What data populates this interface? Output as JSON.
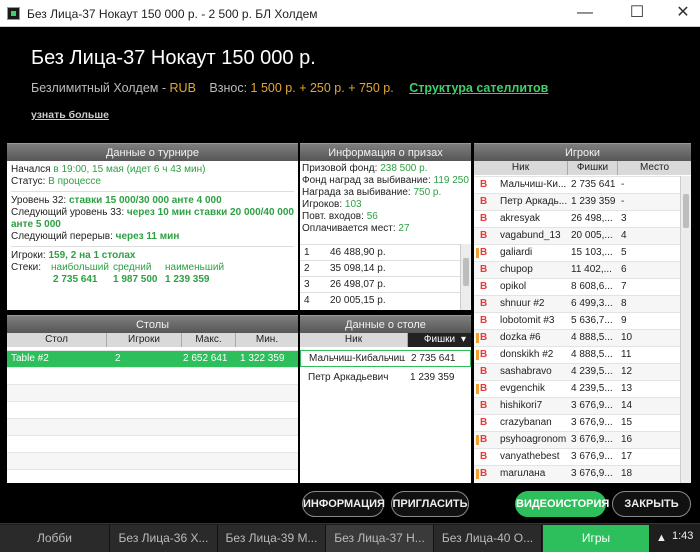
{
  "window": {
    "title": "Без Лица-37 Нокаут 150 000 р. - 2 500 р. БЛ Холдем",
    "min": "—",
    "max": "☐",
    "close": "✕"
  },
  "header": {
    "title": "Без Лица-37 Нокаут 150 000 р.",
    "game": "Безлимитный Холдем - ",
    "currency": "RUB",
    "fee_label": "Взнос:",
    "fee_value": "1 500 р. + 250 р. + 750 р.",
    "satellites_link": "Структура сателлитов",
    "learn_more": "узнать больше"
  },
  "tournament": {
    "heading": "Данные о турнире",
    "started_label": "Начался",
    "started_value": "в 19:00, 15 мая (идет 6 ч 43 мин)",
    "status_label": "Статус:",
    "status_value": "В процессе",
    "level_label": "Уровень 32:",
    "level_value": "ставки 15 000/30 000 анте 4 000",
    "next_level_label": "Следующий уровень 33:",
    "next_level_value": "через 10 мин ставки 20 000/40 000 анте 5 000",
    "next_break_label": "Следующий перерыв:",
    "next_break_value": "через 11 мин",
    "players_label": "Игроки:",
    "players_value": "159, 2 на 1 столах",
    "stacks_label": "Стеки:",
    "stack_largest_label": "наибольший",
    "stack_avg_label": "средний",
    "stack_smallest_label": "наименьший",
    "stack_largest": "2 735 641",
    "stack_avg": "1 987 500",
    "stack_smallest": "1 239 359"
  },
  "prizes": {
    "heading": "Информация о призах",
    "pool_label": "Призовой фонд:",
    "pool_value": "238 500 р.",
    "ko_fund_label": "Фонд наград за выбивание:",
    "ko_fund_value": "119 250 р.",
    "ko_reward_label": "Награда за выбивание:",
    "ko_reward_value": "750 р.",
    "players_label": "Игроков:",
    "players_value": "103",
    "reentries_label": "Повт. входов:",
    "reentries_value": "56",
    "paid_label": "Оплачивается мест:",
    "paid_value": "27",
    "table": [
      {
        "place": "1",
        "prize": "46 488,90 р."
      },
      {
        "place": "2",
        "prize": "35 098,14 р."
      },
      {
        "place": "3",
        "prize": "26 498,07 р."
      },
      {
        "place": "4",
        "prize": "20 005,15 р."
      }
    ]
  },
  "players_panel": {
    "heading": "Игроки",
    "col_nick": "Ник",
    "col_chips": "Фишки",
    "col_place": "Место",
    "rows": [
      {
        "nick": "Мальчиш-Ки...",
        "chips": "2 735 641",
        "place": "-",
        "mark": false
      },
      {
        "nick": "Петр Аркадь...",
        "chips": "1 239 359",
        "place": "-",
        "mark": false
      },
      {
        "nick": "akresyak",
        "chips": "26 498,...",
        "place": "3",
        "mark": false
      },
      {
        "nick": "vagabund_13",
        "chips": "20 005,...",
        "place": "4",
        "mark": false
      },
      {
        "nick": "galiardi",
        "chips": "15 103,...",
        "place": "5",
        "mark": true
      },
      {
        "nick": "chupop",
        "chips": "11 402,...",
        "place": "6",
        "mark": false
      },
      {
        "nick": "opikol",
        "chips": "8 608,6...",
        "place": "7",
        "mark": false
      },
      {
        "nick": "shnuur #2",
        "chips": "6 499,3...",
        "place": "8",
        "mark": false
      },
      {
        "nick": "lobotomit #3",
        "chips": "5 636,7...",
        "place": "9",
        "mark": false
      },
      {
        "nick": "dozka #6",
        "chips": "4 888,5...",
        "place": "10",
        "mark": true
      },
      {
        "nick": "donskikh #2",
        "chips": "4 888,5...",
        "place": "11",
        "mark": true
      },
      {
        "nick": "sashabravo",
        "chips": "4 239,5...",
        "place": "12",
        "mark": false
      },
      {
        "nick": "evgenchik",
        "chips": "4 239,5...",
        "place": "13",
        "mark": true
      },
      {
        "nick": "hishikori7",
        "chips": "3 676,9...",
        "place": "14",
        "mark": false
      },
      {
        "nick": "crazybanan",
        "chips": "3 676,9...",
        "place": "15",
        "mark": false
      },
      {
        "nick": "psyhoagronom",
        "chips": "3 676,9...",
        "place": "16",
        "mark": true
      },
      {
        "nick": "vanyathebest",
        "chips": "3 676,9...",
        "place": "17",
        "mark": false
      },
      {
        "nick": "maruлана",
        "chips": "3 676,9...",
        "place": "18",
        "mark": true
      }
    ]
  },
  "tables": {
    "heading": "Столы",
    "col_table": "Стол",
    "col_players": "Игроки",
    "col_max": "Макс.",
    "col_min": "Мин.",
    "rows": [
      {
        "table": "Table #2",
        "players": "2",
        "max": "2 652 641",
        "min": "1 322 359"
      }
    ]
  },
  "table_data": {
    "heading": "Данные о столе",
    "col_nick": "Ник",
    "col_chips": "Фишки",
    "sort_arrow": "▾",
    "rows": [
      {
        "nick": "Мальчиш-Кибальчиш",
        "chips": "2 735 641"
      },
      {
        "nick": "Петр Аркадьевич",
        "chips": "1 239 359"
      }
    ]
  },
  "buttons": {
    "info": "ИНФОРМАЦИЯ",
    "invite": "ПРИГЛАСИТЬ",
    "video": "ВИДЕОИСТОРИЯ",
    "close": "ЗАКРЫТЬ"
  },
  "taskbar": {
    "lobby": "Лобби",
    "tab1": "Без Лица-36 Х...",
    "tab2": "Без Лица-39 М...",
    "tab3": "Без Лица-37 Н...",
    "tab4": "Без Лица-40 О...",
    "games": "Игры",
    "tray_arrow": "▲",
    "clock": "1:43"
  }
}
